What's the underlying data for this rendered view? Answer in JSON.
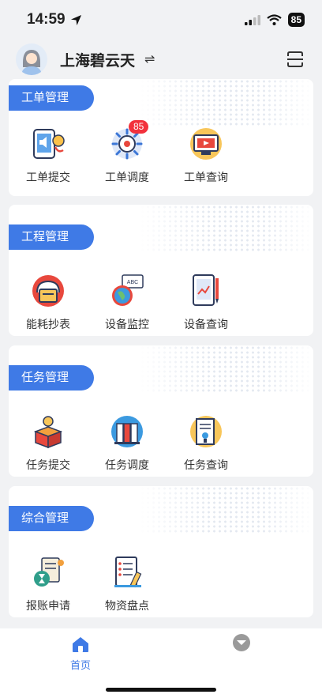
{
  "status_bar": {
    "time": "14:59",
    "battery": "85"
  },
  "header": {
    "company": "上海碧云天",
    "swap_symbol": "⇌"
  },
  "sections": [
    {
      "title": "工单管理",
      "items": [
        {
          "label": "工单提交"
        },
        {
          "label": "工单调度",
          "badge": "85"
        },
        {
          "label": "工单查询"
        }
      ]
    },
    {
      "title": "工程管理",
      "items": [
        {
          "label": "能耗抄表"
        },
        {
          "label": "设备监控"
        },
        {
          "label": "设备查询"
        }
      ]
    },
    {
      "title": "任务管理",
      "items": [
        {
          "label": "任务提交"
        },
        {
          "label": "任务调度"
        },
        {
          "label": "任务查询"
        }
      ]
    },
    {
      "title": "综合管理",
      "items": [
        {
          "label": "报账申请"
        },
        {
          "label": "物资盘点"
        }
      ]
    }
  ],
  "icon_texts": {
    "abc": "ABC"
  },
  "tabbar": {
    "home_label": "首页"
  },
  "colors": {
    "accent": "#3f7ae6",
    "badge": "#f2313c",
    "background": "#f1f2f4"
  }
}
